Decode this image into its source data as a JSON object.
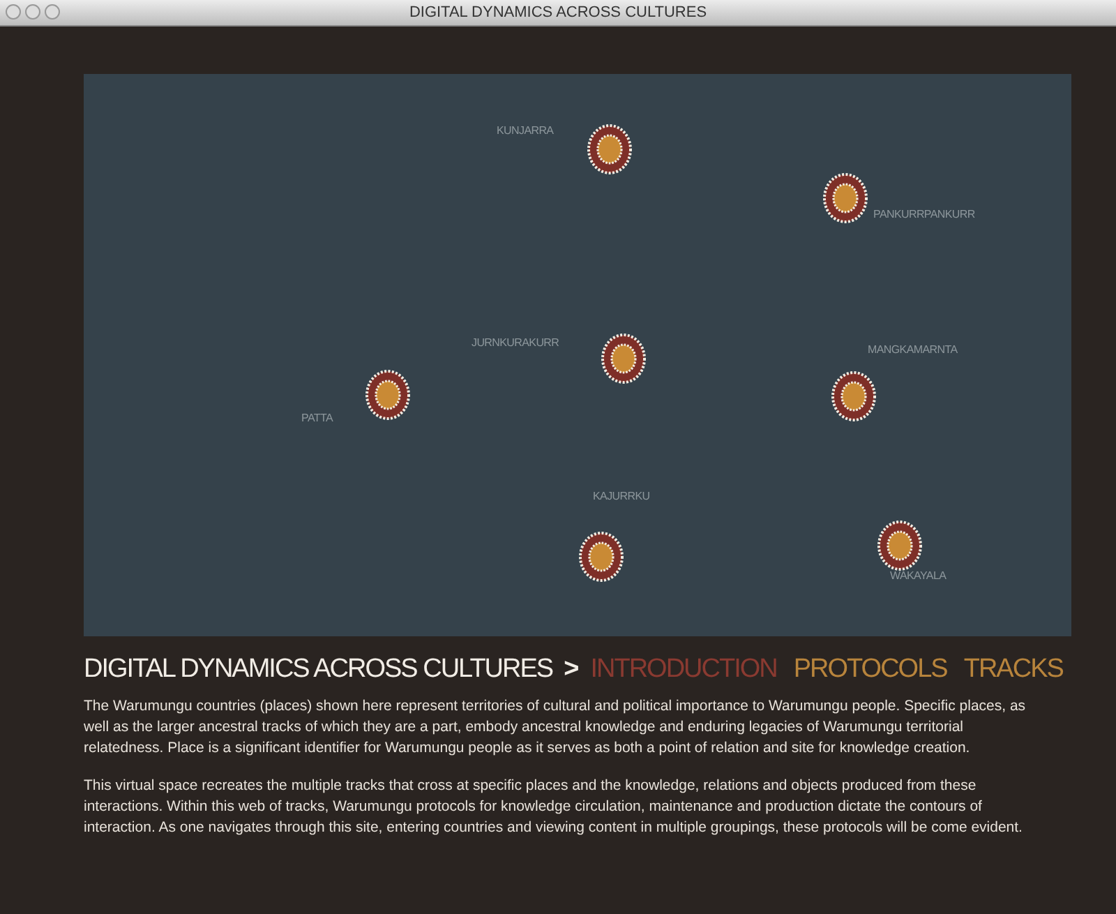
{
  "window": {
    "title": "DIGITAL DYNAMICS ACROSS CULTURES"
  },
  "map": {
    "places": [
      {
        "name": "KUNJARRA"
      },
      {
        "name": "PANKURRPANKURR"
      },
      {
        "name": "JURNKURAKURR"
      },
      {
        "name": "PATTA"
      },
      {
        "name": "MANGKAMARNTA"
      },
      {
        "name": "KAJURRKU"
      },
      {
        "name": "WAKAYALA"
      }
    ]
  },
  "breadcrumb": {
    "site": "DIGITAL DYNAMICS ACROSS CULTURES",
    "separator": ">",
    "sections": [
      {
        "label": "INTRODUCTION",
        "selected": true
      },
      {
        "label": "PROTOCOLS",
        "selected": false
      },
      {
        "label": "TRACKS",
        "selected": false
      }
    ]
  },
  "paragraphs": [
    "The Warumungu countries (places) shown here represent territories of cultural and political importance to Warumungu people. Specific places, as well as the larger ancestral tracks of which they are a part, embody ancestral knowledge and enduring legacies of Warumungu territorial relatedness. Place is a significant identifier for Warumungu people as it serves as both a point of relation and site for knowledge creation.",
    "This virtual space recreates the multiple tracks that cross at specific places and the knowledge, relations and objects produced from these interactions. Within this web of tracks, Warumungu protocols for knowledge circulation, maintenance and production dictate the contours of interaction. As one navigates through this site, entering countries and viewing content in multiple groupings, these protocols will be come evident."
  ]
}
